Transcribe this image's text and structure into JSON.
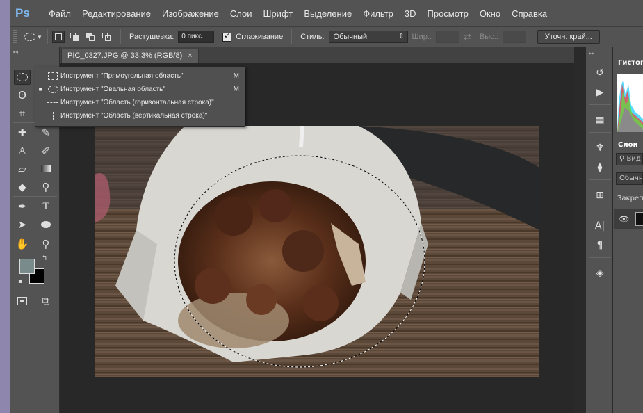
{
  "app": {
    "logo": "Ps"
  },
  "menu": [
    "Файл",
    "Редактирование",
    "Изображение",
    "Слои",
    "Шрифт",
    "Выделение",
    "Фильтр",
    "3D",
    "Просмотр",
    "Окно",
    "Справка"
  ],
  "options": {
    "feather_label": "Растушевка:",
    "feather_value": "0 пикс.",
    "antialias_label": "Сглаживание",
    "style_label": "Стиль:",
    "style_value": "Обычный",
    "width_label": "Шир.:",
    "height_label": "Выс.:",
    "refine_edge_label": "Уточн. край..."
  },
  "document": {
    "tab_title": "PIC_0327.JPG @ 33,3% (RGB/8)",
    "close_glyph": "×"
  },
  "flyout": {
    "items": [
      {
        "label": "Инструмент \"Прямоугольная область\"",
        "shortcut": "M",
        "icon": "rect-marquee-icon",
        "selected": false
      },
      {
        "label": "Инструмент \"Овальная область\"",
        "shortcut": "M",
        "icon": "ellipse-marquee-icon",
        "selected": true
      },
      {
        "label": "Инструмент \"Область (горизонтальная строка)\"",
        "shortcut": "",
        "icon": "single-row-marquee-icon",
        "selected": false
      },
      {
        "label": "Инструмент \"Область (вертикальная строка)\"",
        "shortcut": "",
        "icon": "single-column-marquee-icon",
        "selected": false
      }
    ]
  },
  "colors": {
    "foreground": "#7a8b8c",
    "background": "#000000"
  },
  "panels": {
    "histogram_tab": "Гистогр",
    "layers_tab": "Слои",
    "search_placeholder": "Вид",
    "blend_mode": "Обычн",
    "lock_label": "Закреп"
  }
}
